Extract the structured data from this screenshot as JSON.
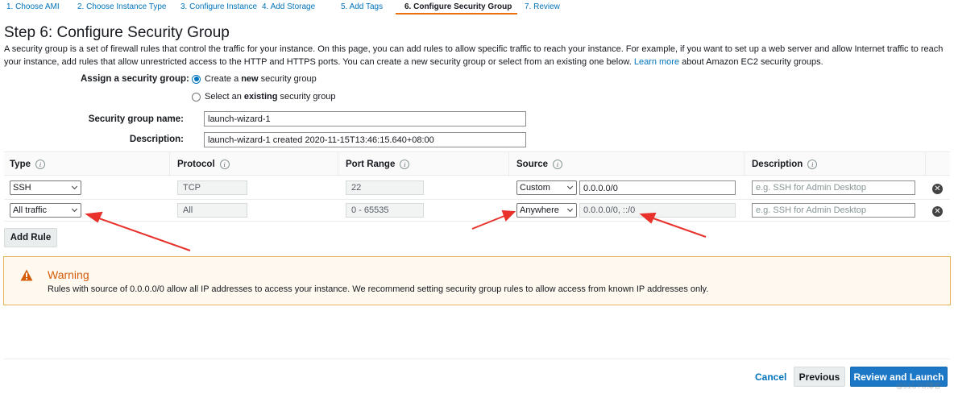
{
  "wizard": {
    "steps": [
      "1. Choose AMI",
      "2. Choose Instance Type",
      "3. Configure Instance",
      "4. Add Storage",
      "5. Add Tags",
      "6. Configure Security Group",
      "7. Review"
    ],
    "active_step": 6,
    "accent_color": "#ec7211"
  },
  "page": {
    "title": "Step 6: Configure Security Group",
    "intro_text": "A security group is a set of firewall rules that control the traffic for your instance. On this page, you can add rules to allow specific traffic to reach your instance. For example, if you want to set up a web server and allow Internet traffic to reach your instance, add rules that allow unrestricted access to the HTTP and HTTPS ports. You can create a new security group or select from an existing one below.",
    "learn_more_link": "Learn more",
    "intro_suffix": "about Amazon EC2 security groups."
  },
  "assign": {
    "label": "Assign a security group:",
    "option_new": {
      "prefix": "Create a",
      "bold": "new",
      "suffix": "security group",
      "selected": true
    },
    "option_existing": {
      "prefix": "Select an",
      "bold": "existing",
      "suffix": "security group",
      "selected": false
    }
  },
  "group": {
    "name_label": "Security group name:",
    "name_value": "launch-wizard-1",
    "description_label": "Description:",
    "description_value": "launch-wizard-1 created 2020-11-15T13:46:15.640+08:00"
  },
  "rules_table": {
    "columns": [
      "Type",
      "Protocol",
      "Port Range",
      "Source",
      "Description"
    ],
    "info_glyph": "i",
    "rows": [
      {
        "type": "SSH",
        "protocol": "TCP",
        "port_range": "22",
        "source_type": "Custom",
        "source_value": "0.0.0.0/0",
        "description_placeholder": "e.g. SSH for Admin Desktop"
      },
      {
        "type": "All traffic",
        "protocol": "All",
        "port_range": "0 - 65535",
        "source_type": "Anywhere",
        "source_value": "0.0.0.0/0, ::/0",
        "description_placeholder": "e.g. SSH for Admin Desktop"
      }
    ],
    "remove_glyph": "✕",
    "add_rule_label": "Add Rule"
  },
  "warning": {
    "title": "Warning",
    "text": "Rules with source of 0.0.0.0/0 allow all IP addresses to access your instance. We recommend setting security group rules to allow access from known IP addresses only.",
    "color": "#d45b07"
  },
  "footer": {
    "cancel_label": "Cancel",
    "previous_label": "Previous",
    "launch_label": "Review and Launch",
    "launch_color": "#1c78c7"
  },
  "annotation_color": "#e8322b",
  "watermark_text": "@51CTO博客"
}
